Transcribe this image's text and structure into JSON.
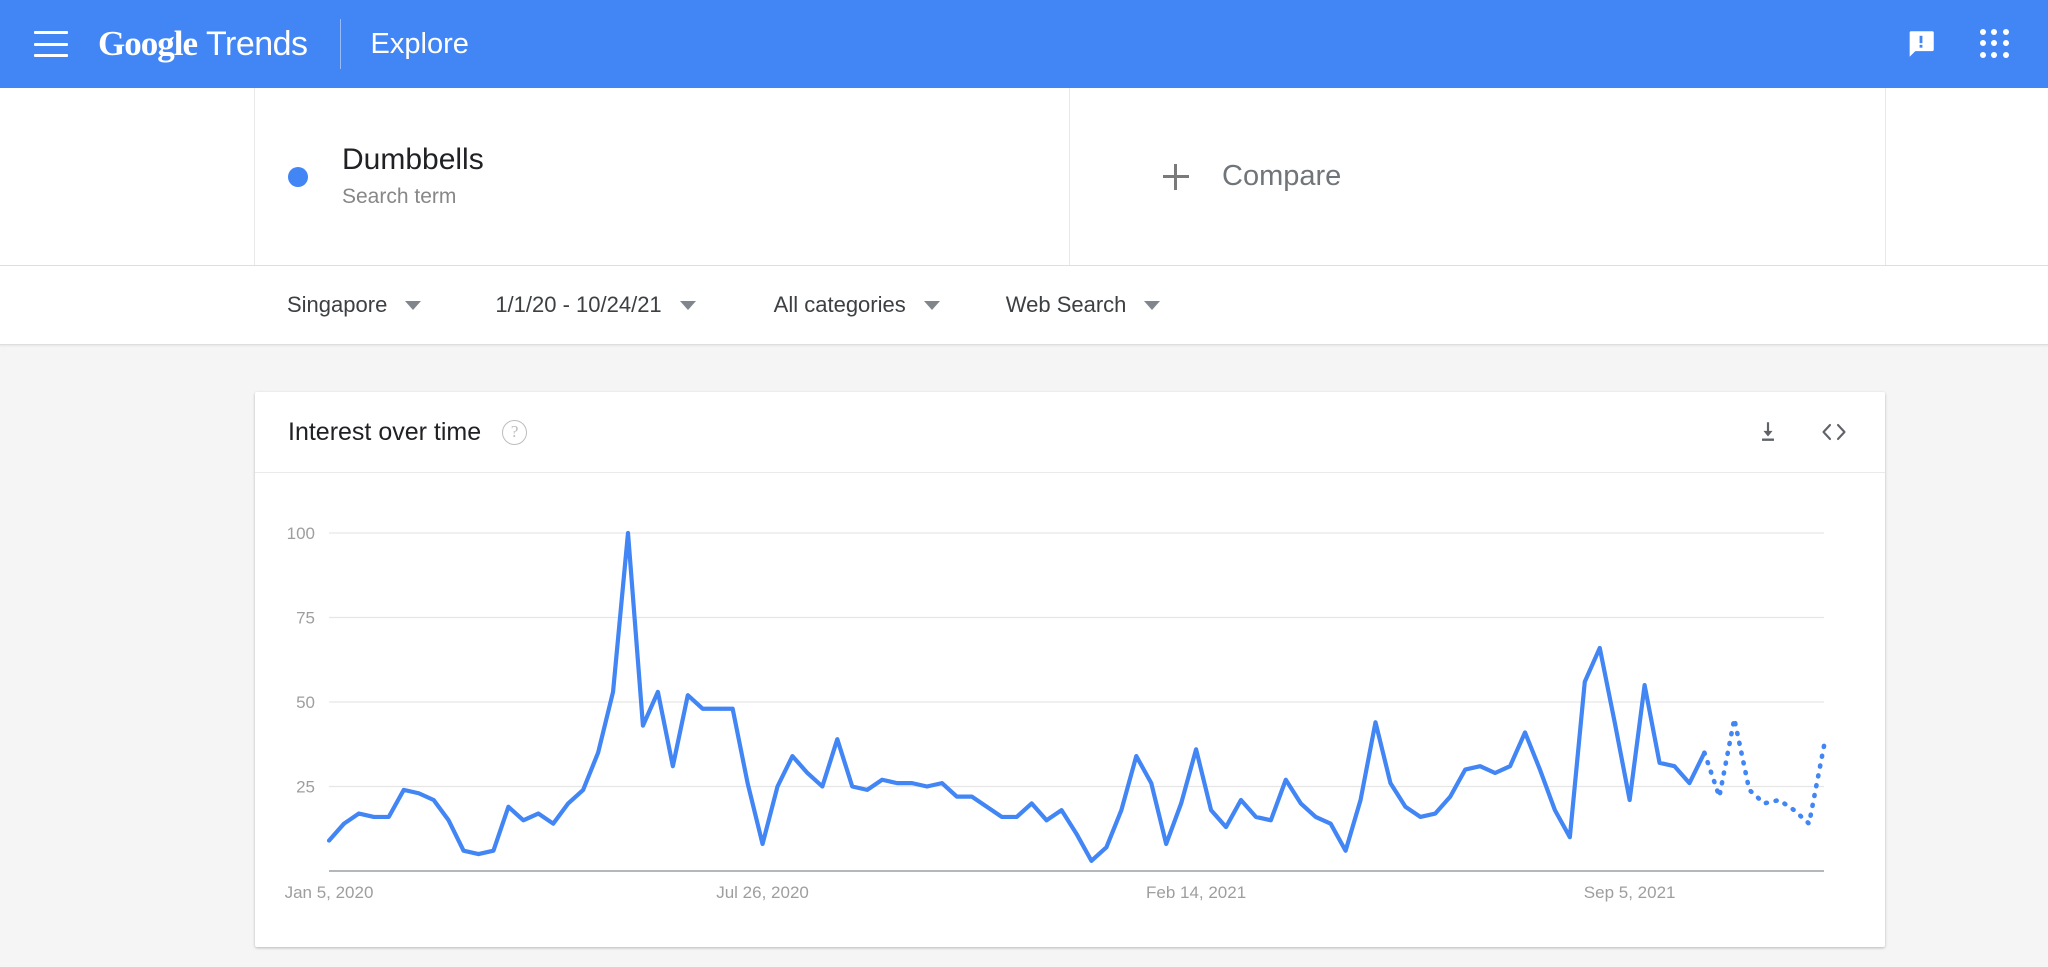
{
  "header": {
    "menu_icon": "hamburger-menu-icon",
    "logo_google": "Google",
    "logo_trends": "Trends",
    "page_label": "Explore",
    "feedback_icon": "feedback-icon",
    "apps_icon": "google-apps-grid-icon",
    "background_color": "#4285f4"
  },
  "search_terms": [
    {
      "title": "Dumbbells",
      "subtitle": "Search term",
      "color": "#4285f4"
    }
  ],
  "compare": {
    "label": "Compare",
    "plus_icon": "plus-icon"
  },
  "filters": [
    {
      "label": "Singapore",
      "name": "location"
    },
    {
      "label": "1/1/20 - 10/24/21",
      "name": "time-range"
    },
    {
      "label": "All categories",
      "name": "category"
    },
    {
      "label": "Web Search",
      "name": "search-type"
    }
  ],
  "card": {
    "title": "Interest over time",
    "help_icon": "help-question-icon",
    "help_glyph": "?",
    "download_icon": "download-icon",
    "embed_icon": "embed-code-icon",
    "embed_glyph": "<>"
  },
  "chart_data": {
    "type": "line",
    "title": "Interest over time",
    "xlabel": "",
    "ylabel": "",
    "ylim": [
      0,
      100
    ],
    "yticks": [
      25,
      50,
      75,
      100
    ],
    "grid": true,
    "legend": "hidden",
    "line_color": "#4285f4",
    "series_name": "Dumbbells",
    "xtick_labels": [
      "Jan 5, 2020",
      "Jul 26, 2020",
      "Feb 14, 2021",
      "Sep 5, 2021"
    ],
    "xtick_indices": [
      0,
      29,
      58,
      87
    ],
    "partial_data_from_index": 92,
    "x": [
      "Jan 5, 2020",
      "Jan 12, 2020",
      "Jan 19, 2020",
      "Jan 26, 2020",
      "Feb 2, 2020",
      "Feb 9, 2020",
      "Feb 16, 2020",
      "Feb 23, 2020",
      "Mar 1, 2020",
      "Mar 8, 2020",
      "Mar 15, 2020",
      "Mar 22, 2020",
      "Mar 29, 2020",
      "Apr 5, 2020",
      "Apr 12, 2020",
      "Apr 19, 2020",
      "Apr 26, 2020",
      "May 3, 2020",
      "May 10, 2020",
      "May 17, 2020",
      "May 24, 2020",
      "May 31, 2020",
      "Jun 7, 2020",
      "Jun 14, 2020",
      "Jun 21, 2020",
      "Jun 28, 2020",
      "Jul 5, 2020",
      "Jul 12, 2020",
      "Jul 19, 2020",
      "Jul 26, 2020",
      "Aug 2, 2020",
      "Aug 9, 2020",
      "Aug 16, 2020",
      "Aug 23, 2020",
      "Aug 30, 2020",
      "Sep 6, 2020",
      "Sep 13, 2020",
      "Sep 20, 2020",
      "Sep 27, 2020",
      "Oct 4, 2020",
      "Oct 11, 2020",
      "Oct 18, 2020",
      "Oct 25, 2020",
      "Nov 1, 2020",
      "Nov 8, 2020",
      "Nov 15, 2020",
      "Nov 22, 2020",
      "Nov 29, 2020",
      "Dec 6, 2020",
      "Dec 13, 2020",
      "Dec 20, 2020",
      "Dec 27, 2020",
      "Jan 3, 2021",
      "Jan 10, 2021",
      "Jan 17, 2021",
      "Jan 24, 2021",
      "Jan 31, 2021",
      "Feb 7, 2021",
      "Feb 14, 2021",
      "Feb 21, 2021",
      "Feb 28, 2021",
      "Mar 7, 2021",
      "Mar 14, 2021",
      "Mar 21, 2021",
      "Mar 28, 2021",
      "Apr 4, 2021",
      "Apr 11, 2021",
      "Apr 18, 2021",
      "Apr 25, 2021",
      "May 2, 2021",
      "May 9, 2021",
      "May 16, 2021",
      "May 23, 2021",
      "May 30, 2021",
      "Jun 6, 2021",
      "Jun 13, 2021",
      "Jun 20, 2021",
      "Jun 27, 2021",
      "Jul 4, 2021",
      "Jul 11, 2021",
      "Jul 18, 2021",
      "Jul 25, 2021",
      "Aug 1, 2021",
      "Aug 8, 2021",
      "Aug 15, 2021",
      "Aug 22, 2021",
      "Aug 29, 2021",
      "Sep 5, 2021",
      "Sep 12, 2021",
      "Sep 19, 2021",
      "Sep 26, 2021",
      "Oct 3, 2021",
      "Oct 10, 2021",
      "Oct 17, 2021",
      "Oct 24, 2021"
    ],
    "values": [
      9,
      14,
      17,
      16,
      16,
      24,
      23,
      21,
      15,
      6,
      5,
      6,
      19,
      15,
      17,
      14,
      20,
      24,
      35,
      53,
      100,
      43,
      53,
      31,
      52,
      48,
      48,
      48,
      26,
      8,
      25,
      34,
      29,
      25,
      39,
      25,
      24,
      27,
      26,
      26,
      25,
      26,
      22,
      22,
      19,
      16,
      16,
      20,
      15,
      18,
      11,
      3,
      7,
      18,
      34,
      26,
      8,
      20,
      36,
      18,
      13,
      21,
      16,
      15,
      27,
      20,
      16,
      14,
      6,
      21,
      44,
      26,
      19,
      16,
      17,
      22,
      30,
      31,
      29,
      31,
      41,
      30,
      18,
      10,
      56,
      66,
      44,
      21,
      55,
      32,
      31,
      26,
      35,
      22,
      45,
      24,
      20,
      21,
      18,
      14,
      37
    ]
  }
}
